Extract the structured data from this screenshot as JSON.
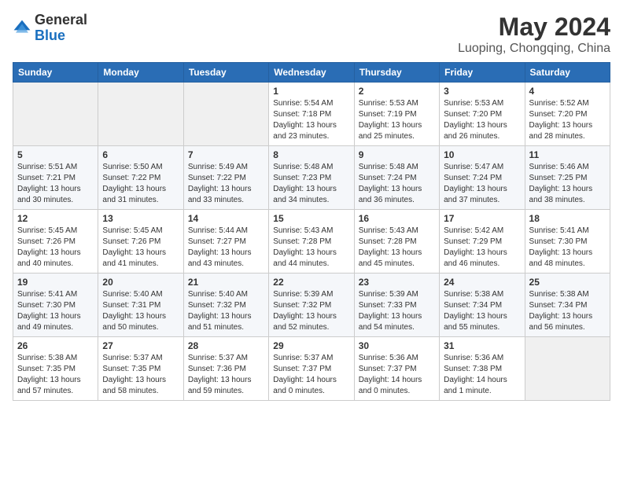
{
  "header": {
    "logo": {
      "general": "General",
      "blue": "Blue"
    },
    "title": "May 2024",
    "location": "Luoping, Chongqing, China"
  },
  "calendar": {
    "headers": [
      "Sunday",
      "Monday",
      "Tuesday",
      "Wednesday",
      "Thursday",
      "Friday",
      "Saturday"
    ],
    "weeks": [
      [
        {
          "day": "",
          "info": ""
        },
        {
          "day": "",
          "info": ""
        },
        {
          "day": "",
          "info": ""
        },
        {
          "day": "1",
          "info": "Sunrise: 5:54 AM\nSunset: 7:18 PM\nDaylight: 13 hours\nand 23 minutes."
        },
        {
          "day": "2",
          "info": "Sunrise: 5:53 AM\nSunset: 7:19 PM\nDaylight: 13 hours\nand 25 minutes."
        },
        {
          "day": "3",
          "info": "Sunrise: 5:53 AM\nSunset: 7:20 PM\nDaylight: 13 hours\nand 26 minutes."
        },
        {
          "day": "4",
          "info": "Sunrise: 5:52 AM\nSunset: 7:20 PM\nDaylight: 13 hours\nand 28 minutes."
        }
      ],
      [
        {
          "day": "5",
          "info": "Sunrise: 5:51 AM\nSunset: 7:21 PM\nDaylight: 13 hours\nand 30 minutes."
        },
        {
          "day": "6",
          "info": "Sunrise: 5:50 AM\nSunset: 7:22 PM\nDaylight: 13 hours\nand 31 minutes."
        },
        {
          "day": "7",
          "info": "Sunrise: 5:49 AM\nSunset: 7:22 PM\nDaylight: 13 hours\nand 33 minutes."
        },
        {
          "day": "8",
          "info": "Sunrise: 5:48 AM\nSunset: 7:23 PM\nDaylight: 13 hours\nand 34 minutes."
        },
        {
          "day": "9",
          "info": "Sunrise: 5:48 AM\nSunset: 7:24 PM\nDaylight: 13 hours\nand 36 minutes."
        },
        {
          "day": "10",
          "info": "Sunrise: 5:47 AM\nSunset: 7:24 PM\nDaylight: 13 hours\nand 37 minutes."
        },
        {
          "day": "11",
          "info": "Sunrise: 5:46 AM\nSunset: 7:25 PM\nDaylight: 13 hours\nand 38 minutes."
        }
      ],
      [
        {
          "day": "12",
          "info": "Sunrise: 5:45 AM\nSunset: 7:26 PM\nDaylight: 13 hours\nand 40 minutes."
        },
        {
          "day": "13",
          "info": "Sunrise: 5:45 AM\nSunset: 7:26 PM\nDaylight: 13 hours\nand 41 minutes."
        },
        {
          "day": "14",
          "info": "Sunrise: 5:44 AM\nSunset: 7:27 PM\nDaylight: 13 hours\nand 43 minutes."
        },
        {
          "day": "15",
          "info": "Sunrise: 5:43 AM\nSunset: 7:28 PM\nDaylight: 13 hours\nand 44 minutes."
        },
        {
          "day": "16",
          "info": "Sunrise: 5:43 AM\nSunset: 7:28 PM\nDaylight: 13 hours\nand 45 minutes."
        },
        {
          "day": "17",
          "info": "Sunrise: 5:42 AM\nSunset: 7:29 PM\nDaylight: 13 hours\nand 46 minutes."
        },
        {
          "day": "18",
          "info": "Sunrise: 5:41 AM\nSunset: 7:30 PM\nDaylight: 13 hours\nand 48 minutes."
        }
      ],
      [
        {
          "day": "19",
          "info": "Sunrise: 5:41 AM\nSunset: 7:30 PM\nDaylight: 13 hours\nand 49 minutes."
        },
        {
          "day": "20",
          "info": "Sunrise: 5:40 AM\nSunset: 7:31 PM\nDaylight: 13 hours\nand 50 minutes."
        },
        {
          "day": "21",
          "info": "Sunrise: 5:40 AM\nSunset: 7:32 PM\nDaylight: 13 hours\nand 51 minutes."
        },
        {
          "day": "22",
          "info": "Sunrise: 5:39 AM\nSunset: 7:32 PM\nDaylight: 13 hours\nand 52 minutes."
        },
        {
          "day": "23",
          "info": "Sunrise: 5:39 AM\nSunset: 7:33 PM\nDaylight: 13 hours\nand 54 minutes."
        },
        {
          "day": "24",
          "info": "Sunrise: 5:38 AM\nSunset: 7:34 PM\nDaylight: 13 hours\nand 55 minutes."
        },
        {
          "day": "25",
          "info": "Sunrise: 5:38 AM\nSunset: 7:34 PM\nDaylight: 13 hours\nand 56 minutes."
        }
      ],
      [
        {
          "day": "26",
          "info": "Sunrise: 5:38 AM\nSunset: 7:35 PM\nDaylight: 13 hours\nand 57 minutes."
        },
        {
          "day": "27",
          "info": "Sunrise: 5:37 AM\nSunset: 7:35 PM\nDaylight: 13 hours\nand 58 minutes."
        },
        {
          "day": "28",
          "info": "Sunrise: 5:37 AM\nSunset: 7:36 PM\nDaylight: 13 hours\nand 59 minutes."
        },
        {
          "day": "29",
          "info": "Sunrise: 5:37 AM\nSunset: 7:37 PM\nDaylight: 14 hours\nand 0 minutes."
        },
        {
          "day": "30",
          "info": "Sunrise: 5:36 AM\nSunset: 7:37 PM\nDaylight: 14 hours\nand 0 minutes."
        },
        {
          "day": "31",
          "info": "Sunrise: 5:36 AM\nSunset: 7:38 PM\nDaylight: 14 hours\nand 1 minute."
        },
        {
          "day": "",
          "info": ""
        }
      ]
    ]
  }
}
